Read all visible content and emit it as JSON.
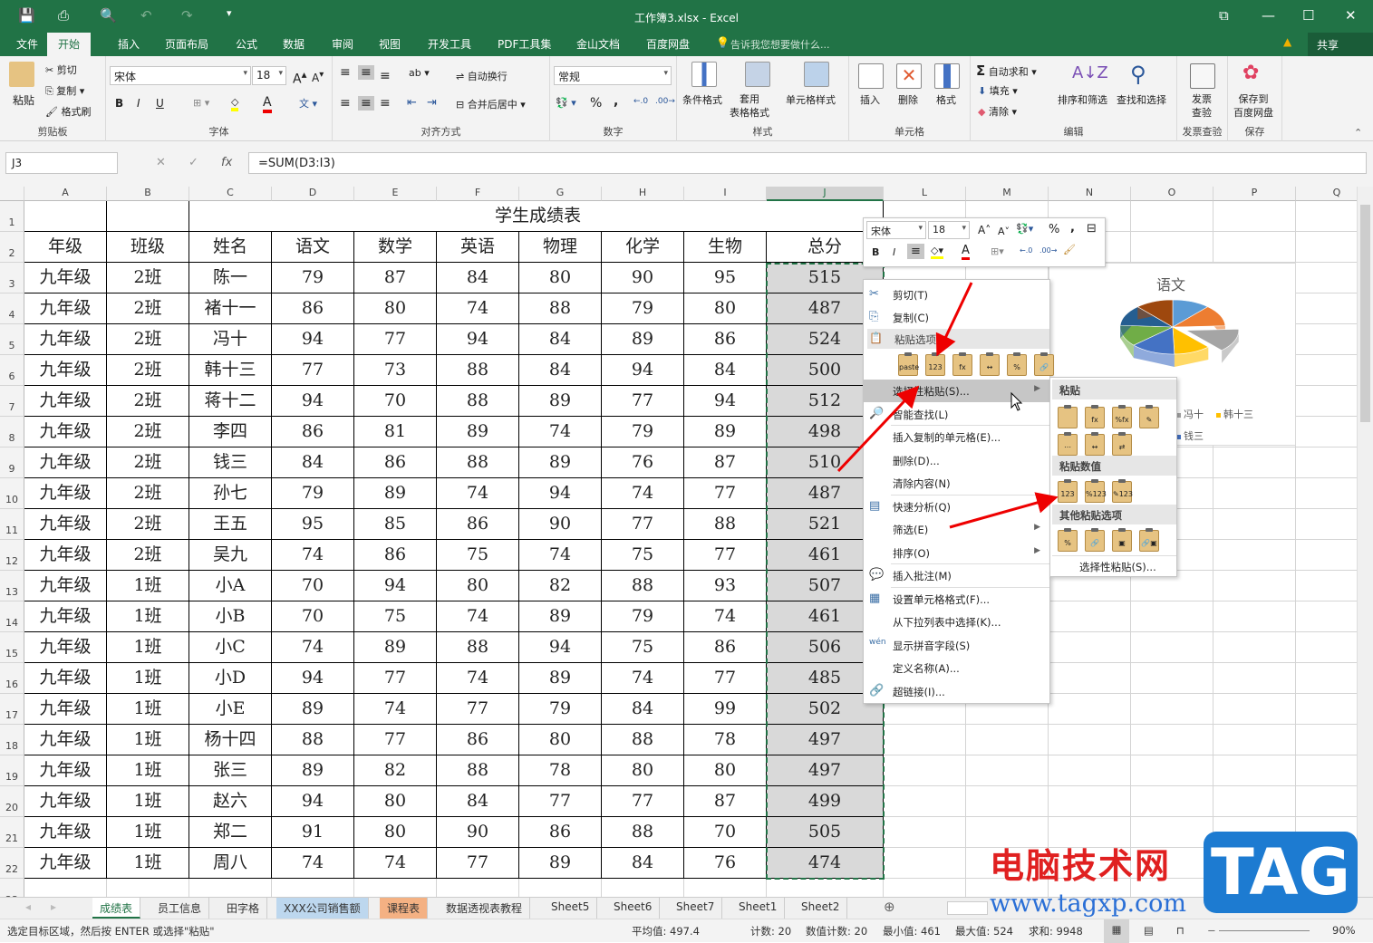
{
  "window": {
    "title": "工作簿3.xlsx - Excel",
    "restore": "⧉",
    "minimize": "—",
    "maximize": "☐",
    "close": "✕"
  },
  "quick_access": {
    "save": "💾",
    "print": "⎙",
    "preview": "🔍",
    "undo": "↶",
    "redo": "↷",
    "customize": "▾"
  },
  "ribbon_tabs": [
    "文件",
    "开始",
    "插入",
    "页面布局",
    "公式",
    "数据",
    "审阅",
    "视图",
    "开发工具",
    "PDF工具集",
    "金山文档",
    "百度网盘"
  ],
  "tell_me": "告诉我您想要做什么...",
  "share": "共享",
  "ribbon": {
    "clipboard": {
      "label": "剪贴板",
      "paste": "粘贴",
      "cut": "剪切",
      "copy": "复制",
      "format_painter": "格式刷"
    },
    "font": {
      "label": "字体",
      "name": "宋体",
      "size": "18",
      "bold": "B",
      "italic": "I",
      "underline": "U"
    },
    "alignment": {
      "label": "对齐方式",
      "wrap": "自动换行",
      "merge": "合并后居中"
    },
    "number": {
      "label": "数字",
      "format": "常规",
      "percent": "%",
      "comma": ","
    },
    "styles": {
      "label": "样式",
      "conditional": "条件格式",
      "table": "套用\n表格格式",
      "cell_styles": "单元格样式"
    },
    "cells": {
      "label": "单元格",
      "insert": "插入",
      "delete": "删除",
      "format": "格式"
    },
    "editing": {
      "label": "编辑",
      "autosum": "自动求和",
      "fill": "填充",
      "clear": "清除",
      "sort": "排序和筛选",
      "find": "查找和选择"
    },
    "invoice": {
      "label": "发票查验",
      "btn": "发票\n查验"
    },
    "save": {
      "label": "保存",
      "btn": "保存到\n百度网盘"
    }
  },
  "formula_bar": {
    "name_box": "J3",
    "formula": "=SUM(D3:I3)",
    "fx": "fx",
    "cancel": "✕",
    "enter": "✓"
  },
  "columns": [
    "A",
    "B",
    "C",
    "D",
    "E",
    "F",
    "G",
    "H",
    "I",
    "J",
    "L",
    "M",
    "N",
    "O",
    "P",
    "Q"
  ],
  "sheet": {
    "title": "学生成绩表",
    "headers": [
      "年级",
      "班级",
      "姓名",
      "语文",
      "数学",
      "英语",
      "物理",
      "化学",
      "生物",
      "总分"
    ],
    "rows": [
      [
        "九年级",
        "2班",
        "陈一",
        "79",
        "87",
        "84",
        "80",
        "90",
        "95",
        "515"
      ],
      [
        "九年级",
        "2班",
        "褚十一",
        "86",
        "80",
        "74",
        "88",
        "79",
        "80",
        "487"
      ],
      [
        "九年级",
        "2班",
        "冯十",
        "94",
        "77",
        "94",
        "84",
        "89",
        "86",
        "524"
      ],
      [
        "九年级",
        "2班",
        "韩十三",
        "77",
        "73",
        "88",
        "84",
        "94",
        "84",
        "500"
      ],
      [
        "九年级",
        "2班",
        "蒋十二",
        "94",
        "70",
        "88",
        "89",
        "77",
        "94",
        "512"
      ],
      [
        "九年级",
        "2班",
        "李四",
        "86",
        "81",
        "89",
        "74",
        "79",
        "89",
        "498"
      ],
      [
        "九年级",
        "2班",
        "钱三",
        "84",
        "86",
        "88",
        "89",
        "76",
        "87",
        "510"
      ],
      [
        "九年级",
        "2班",
        "孙七",
        "79",
        "89",
        "74",
        "94",
        "74",
        "77",
        "487"
      ],
      [
        "九年级",
        "2班",
        "王五",
        "95",
        "85",
        "86",
        "90",
        "77",
        "88",
        "521"
      ],
      [
        "九年级",
        "2班",
        "吴九",
        "74",
        "86",
        "75",
        "74",
        "75",
        "77",
        "461"
      ],
      [
        "九年级",
        "1班",
        "小A",
        "70",
        "94",
        "80",
        "82",
        "88",
        "93",
        "507"
      ],
      [
        "九年级",
        "1班",
        "小B",
        "70",
        "75",
        "74",
        "89",
        "79",
        "74",
        "461"
      ],
      [
        "九年级",
        "1班",
        "小C",
        "74",
        "89",
        "88",
        "94",
        "75",
        "86",
        "506"
      ],
      [
        "九年级",
        "1班",
        "小D",
        "94",
        "77",
        "74",
        "89",
        "74",
        "77",
        "485"
      ],
      [
        "九年级",
        "1班",
        "小E",
        "89",
        "74",
        "77",
        "79",
        "84",
        "99",
        "502"
      ],
      [
        "九年级",
        "1班",
        "杨十四",
        "88",
        "77",
        "86",
        "80",
        "88",
        "78",
        "497"
      ],
      [
        "九年级",
        "1班",
        "张三",
        "89",
        "82",
        "88",
        "78",
        "80",
        "80",
        "497"
      ],
      [
        "九年级",
        "1班",
        "赵六",
        "94",
        "80",
        "84",
        "77",
        "77",
        "87",
        "499"
      ],
      [
        "九年级",
        "1班",
        "郑二",
        "91",
        "80",
        "90",
        "86",
        "88",
        "70",
        "505"
      ],
      [
        "九年级",
        "1班",
        "周八",
        "74",
        "74",
        "77",
        "89",
        "84",
        "76",
        "474"
      ]
    ]
  },
  "mini_toolbar": {
    "font": "宋体",
    "size": "18",
    "bold": "B",
    "italic": "I",
    "percent": "%",
    "comma": ","
  },
  "context_menu": [
    {
      "label": "剪切(T)",
      "icon": "✂"
    },
    {
      "label": "复制(C)",
      "icon": "⎘"
    },
    {
      "label": "粘贴选项:",
      "header": true,
      "icon": "📋"
    },
    {
      "label": "选择性粘贴(S)...",
      "sub": true
    },
    {
      "label": "智能查找(L)",
      "icon": "🔎"
    },
    {
      "label": "插入复制的单元格(E)..."
    },
    {
      "label": "删除(D)..."
    },
    {
      "label": "清除内容(N)"
    },
    {
      "label": "快速分析(Q)",
      "icon": "▤"
    },
    {
      "label": "筛选(E)",
      "sub": true
    },
    {
      "label": "排序(O)",
      "sub": true
    },
    {
      "label": "插入批注(M)",
      "icon": "💬"
    },
    {
      "label": "设置单元格格式(F)...",
      "icon": "▦"
    },
    {
      "label": "从下拉列表中选择(K)..."
    },
    {
      "label": "显示拼音字段(S)",
      "icon": "wén"
    },
    {
      "label": "定义名称(A)..."
    },
    {
      "label": "超链接(I)...",
      "icon": "🔗"
    }
  ],
  "paste_icons": [
    "paste",
    "123",
    "fx",
    "↔",
    "%",
    "🔗"
  ],
  "submenu": {
    "paste": "粘贴",
    "values": "粘贴数值",
    "other": "其他粘贴选项",
    "special": "选择性粘贴(S)...",
    "paste_icons": [
      "",
      "fx",
      "%fx",
      "✎",
      "⋯",
      "↔",
      "⇄"
    ],
    "value_icons": [
      "123",
      "%123",
      "✎123"
    ],
    "other_icons": [
      "%",
      "🔗",
      "▣",
      "🔗▣"
    ]
  },
  "chart": {
    "title": "语文",
    "legend": [
      "冯十",
      "韩十三",
      "钱三"
    ],
    "colors": [
      "#5b9bd5",
      "#ed7d31",
      "#a5a5a5",
      "#ffc000",
      "#4472c4",
      "#70ad47",
      "#255e91",
      "#9e480e"
    ]
  },
  "sheet_tabs": [
    {
      "name": "成绩表",
      "active": true
    },
    {
      "name": "员工信息"
    },
    {
      "name": "田字格"
    },
    {
      "name": "XXX公司销售额",
      "color": "#bdd7ee"
    },
    {
      "name": "课程表",
      "color": "#f4b183"
    },
    {
      "name": "数据透视表教程"
    },
    {
      "name": "Sheet5"
    },
    {
      "name": "Sheet6"
    },
    {
      "name": "Sheet7"
    },
    {
      "name": "Sheet1"
    },
    {
      "name": "Sheet2"
    }
  ],
  "status": {
    "message": "选定目标区域，然后按 ENTER 或选择\"粘贴\"",
    "average": "平均值: 497.4",
    "count": "计数: 20",
    "numeric_count": "数值计数: 20",
    "min": "最小值: 461",
    "max": "最大值: 524",
    "sum": "求和: 9948",
    "zoom": "90%"
  },
  "watermark": {
    "site_name": "电脑技术网",
    "url": "www.tagxp.com",
    "logo": "TAG"
  }
}
